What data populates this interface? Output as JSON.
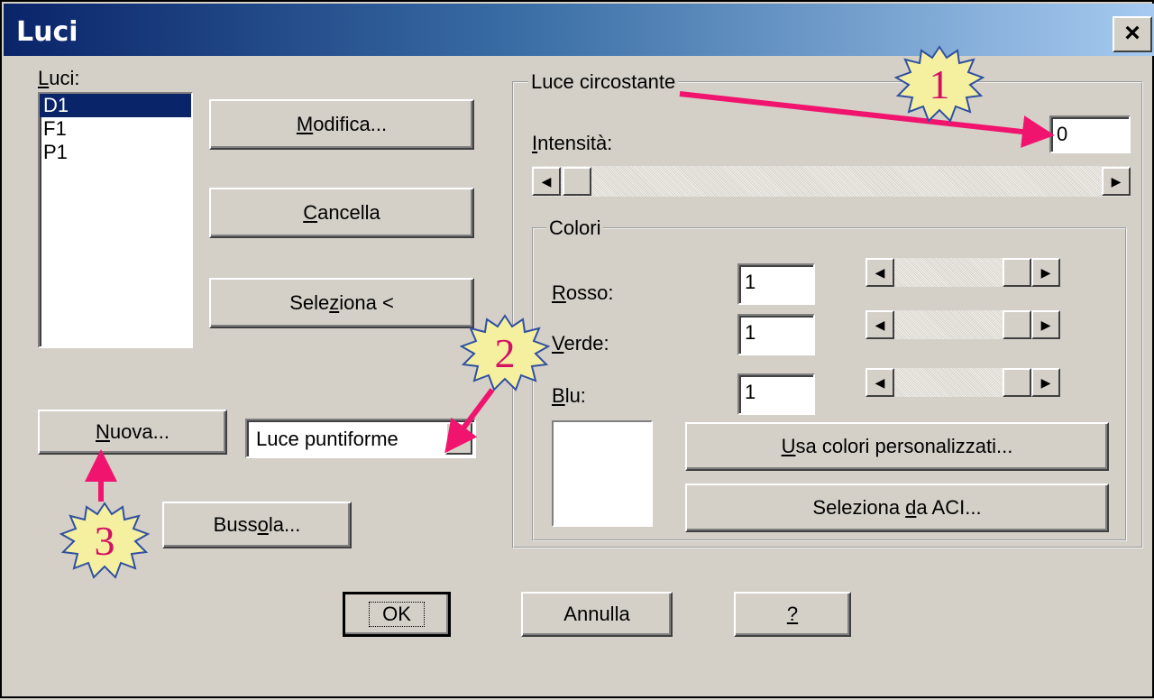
{
  "window": {
    "title": "Luci",
    "close_label": "×"
  },
  "lights": {
    "label": "Luci:",
    "items": [
      "D1",
      "F1",
      "P1"
    ],
    "selected": "D1"
  },
  "buttons": {
    "modify": "Modifica...",
    "delete": "Cancella",
    "select": "Seleziona <",
    "new": "Nuova...",
    "compass": "Bussola...",
    "ok": "OK",
    "cancel": "Annulla",
    "help": "?",
    "custom_colors": "Usa colori personalizzati...",
    "select_aci": "Seleziona da ACI..."
  },
  "light_type": {
    "value": "Luce puntiforme",
    "arrow": "▼"
  },
  "ambient": {
    "group_title": "Luce circostante",
    "intensity_label": "Intensità:",
    "intensity_value": "0",
    "intensity_level": 0.0
  },
  "colors": {
    "group_title": "Colori",
    "red_label": "Rosso:",
    "red_value": "1",
    "green_label": "Verde:",
    "green_value": "1",
    "blue_label": "Blu:",
    "blue_value": "1",
    "preview_color": "#ffffff"
  },
  "scroll_glyphs": {
    "left": "◀",
    "right": "▶"
  },
  "callouts": {
    "one": "1",
    "two": "2",
    "three": "3",
    "star_fill": "#f5f0a0",
    "star_stroke": "#3050a0",
    "arrow_color": "#f0146e"
  }
}
